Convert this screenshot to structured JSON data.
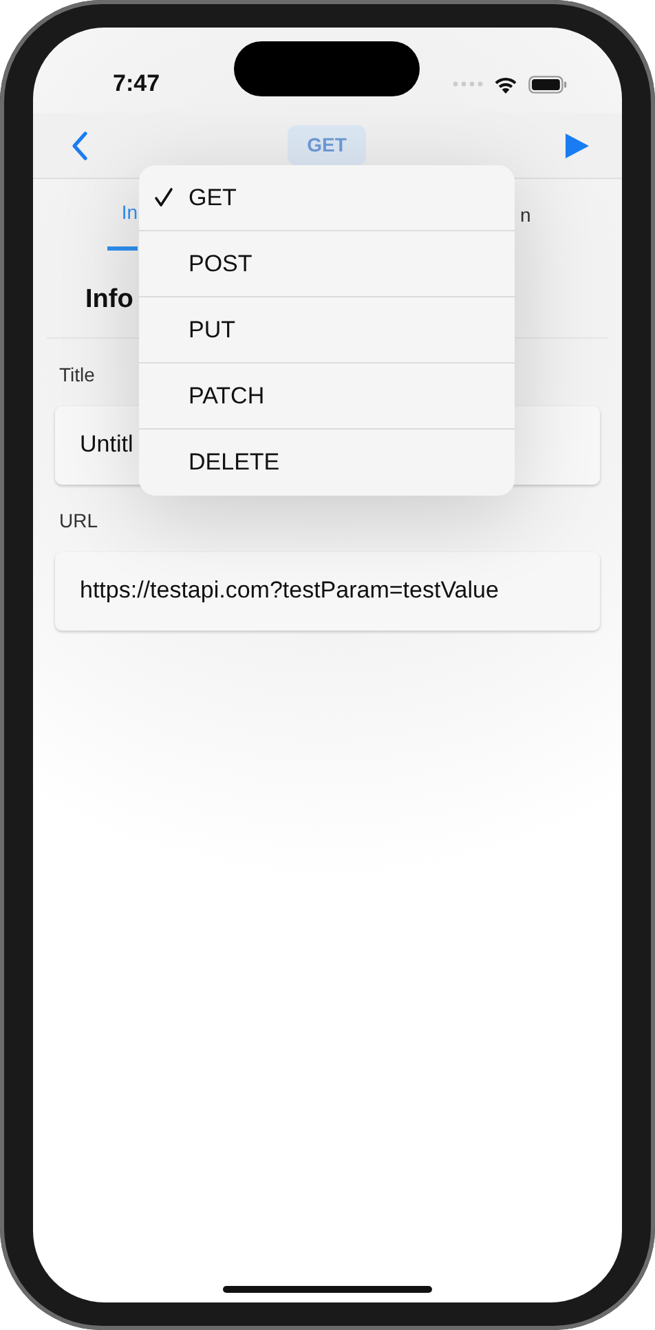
{
  "status_bar": {
    "time": "7:47"
  },
  "nav_bar": {
    "method_button": "GET"
  },
  "tabs": [
    {
      "label": "In",
      "selected": true
    },
    {
      "label": "n",
      "selected": false
    }
  ],
  "section": {
    "title": "Info"
  },
  "fields": [
    {
      "label": "Title",
      "value": "Untitl"
    },
    {
      "label": "URL",
      "value": "https://testapi.com?testParam=testValue"
    }
  ],
  "method_menu": {
    "items": [
      {
        "label": "GET",
        "selected": true
      },
      {
        "label": "POST",
        "selected": false
      },
      {
        "label": "PUT",
        "selected": false
      },
      {
        "label": "PATCH",
        "selected": false
      },
      {
        "label": "DELETE",
        "selected": false
      }
    ]
  }
}
